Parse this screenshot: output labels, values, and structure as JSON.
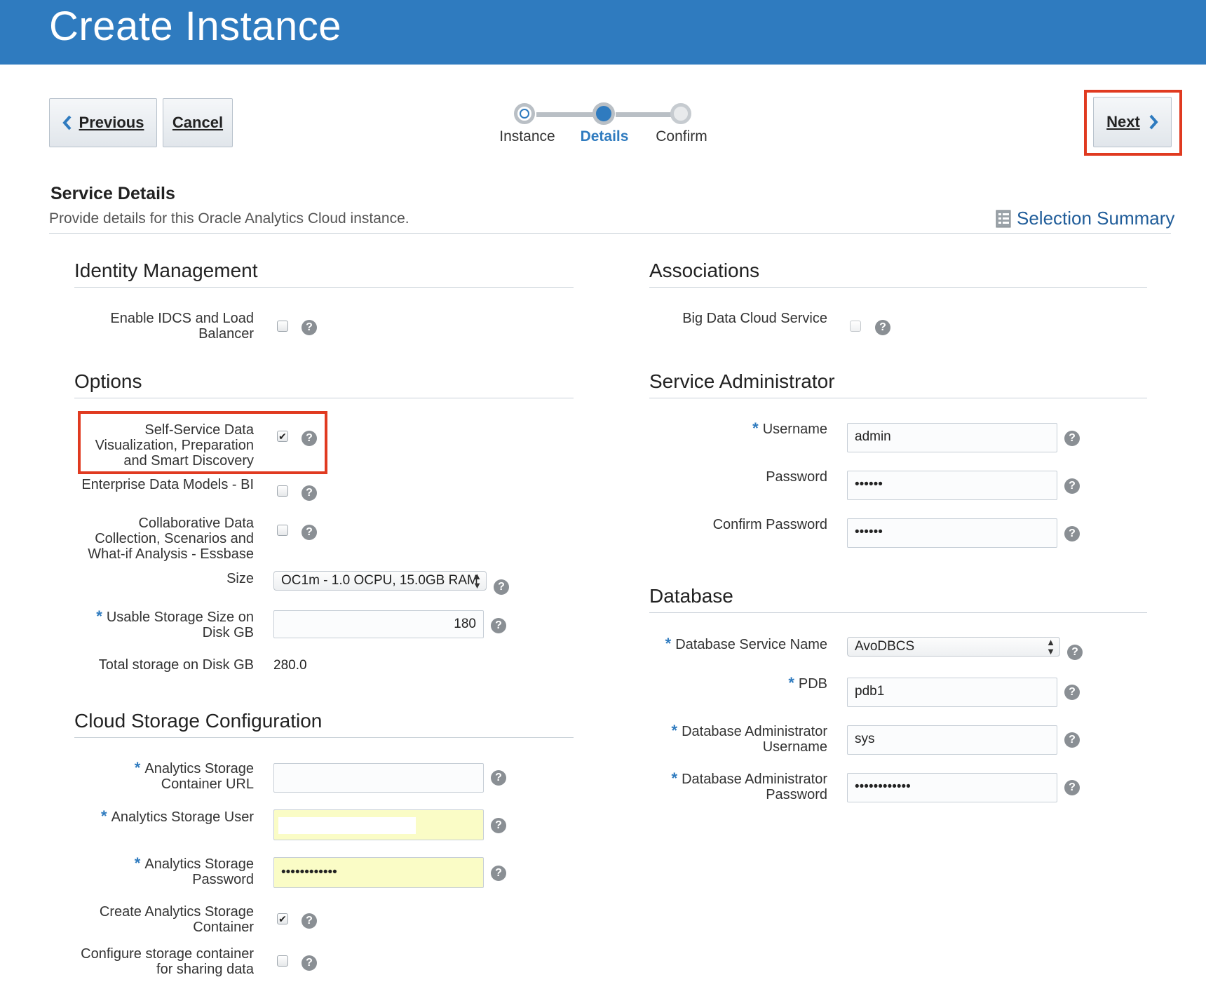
{
  "header": {
    "title": "Create Instance"
  },
  "nav": {
    "previous_label": "Previous",
    "cancel_label": "Cancel",
    "next_label": "Next"
  },
  "train": {
    "steps": [
      {
        "label": "Instance",
        "state": "visited"
      },
      {
        "label": "Details",
        "state": "current"
      },
      {
        "label": "Confirm",
        "state": "unvisited"
      }
    ]
  },
  "service": {
    "heading": "Service Details",
    "description": "Provide details for this Oracle Analytics Cloud instance.",
    "summary_link": "Selection Summary"
  },
  "identity": {
    "title": "Identity Management",
    "idcs_label": "Enable IDCS and Load Balancer",
    "idcs_checked": false
  },
  "options": {
    "title": "Options",
    "ssdv_label": "Self-Service Data Visualization, Preparation and Smart Discovery",
    "ssdv_checked": true,
    "edm_label": "Enterprise Data Models - BI",
    "edm_checked": false,
    "essbase_label": "Collaborative Data Collection, Scenarios and What-if Analysis - Essbase",
    "essbase_checked": false,
    "size_label": "Size",
    "size_value": "OC1m - 1.0 OCPU, 15.0GB RAM",
    "usable_label": "Usable Storage Size on Disk GB",
    "usable_value": "180",
    "total_label": "Total storage on Disk GB",
    "total_value": "280.0"
  },
  "cloud_storage": {
    "title": "Cloud Storage Configuration",
    "url_label": "Analytics Storage Container URL",
    "url_value": "",
    "user_label": "Analytics Storage User",
    "user_value": "",
    "password_label": "Analytics Storage Password",
    "password_value": "••••••••••••",
    "create_label": "Create Analytics Storage Container",
    "create_checked": true,
    "share_label": "Configure storage container for sharing data",
    "share_checked": false
  },
  "associations": {
    "title": "Associations",
    "bigdata_label": "Big Data Cloud Service",
    "bigdata_checked": false
  },
  "service_admin": {
    "title": "Service Administrator",
    "username_label": "Username",
    "username_value": "admin",
    "password_label": "Password",
    "password_value": "••••••",
    "confirm_label": "Confirm Password",
    "confirm_value": "••••••"
  },
  "database": {
    "title": "Database",
    "service_name_label": "Database Service Name",
    "service_name_value": "AvoDBCS",
    "pdb_label": "PDB",
    "pdb_value": "pdb1",
    "admin_user_label": "Database Administrator Username",
    "admin_user_value": "sys",
    "admin_pw_label": "Database Administrator Password",
    "admin_pw_value": "••••••••••••"
  },
  "icons": {
    "help": "?",
    "check": "✔"
  },
  "colors": {
    "header": "#2f7bbf",
    "highlight": "#e03a20",
    "link": "#1f5c99"
  }
}
